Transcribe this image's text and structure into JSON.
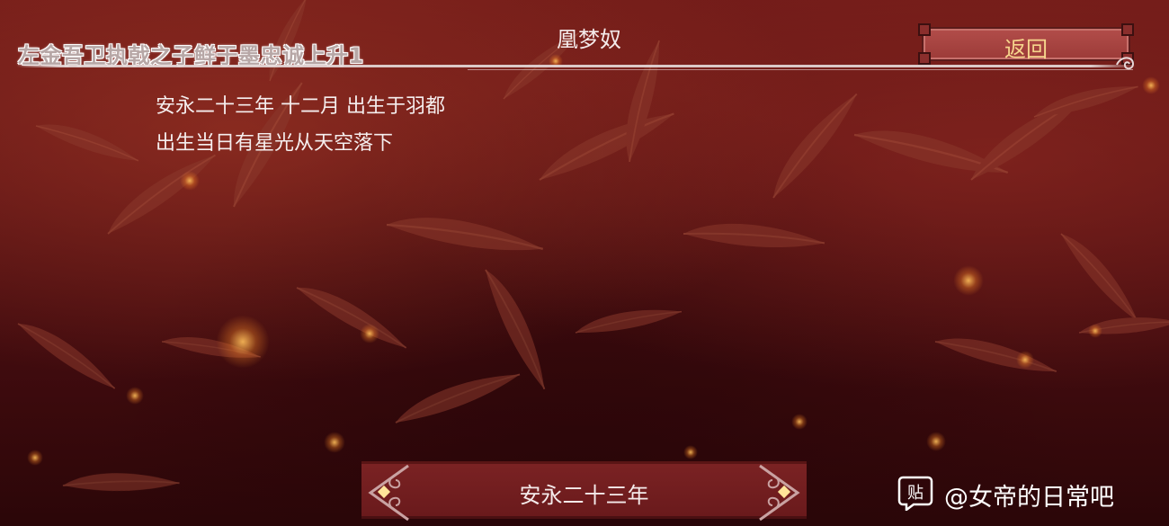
{
  "header": {
    "subtitle": "左金吾卫执戟之子鲜于墨忠诚上升1",
    "character_name": "凰梦奴",
    "back_label": "返回"
  },
  "event": {
    "date_line": "安永二十三年 十二月 出生于羽都",
    "description": "出生当日有星光从天空落下"
  },
  "year_selector": {
    "current_year": "安永二十三年"
  },
  "watermark": {
    "logo_glyph": "贴",
    "text": "@女帝的日常吧"
  },
  "colors": {
    "background": "#5a1214",
    "accent_gold": "#f6d58c",
    "button_red": "#9c3b38",
    "selector_bg": "#7a2223"
  }
}
